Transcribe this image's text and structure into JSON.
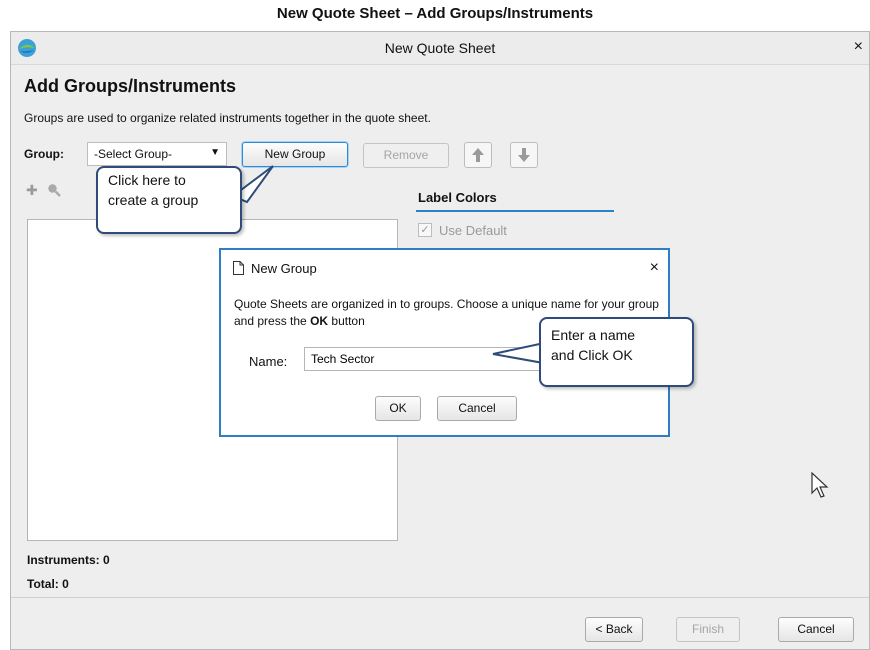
{
  "doc_title": "New Quote Sheet – Add Groups/Instruments",
  "window": {
    "title": "New Quote Sheet",
    "close": "×",
    "heading": "Add Groups/Instruments",
    "description": "Groups are used to organize related instruments together in the quote sheet."
  },
  "group_row": {
    "label": "Group:",
    "selected": "-Select Group-",
    "dropdown_arrow": "▼",
    "new_group": "New Group",
    "remove": "Remove",
    "up_icon": "arrow-up-icon",
    "down_icon": "arrow-down-icon"
  },
  "toolbar_icons": [
    "plus-icon",
    "zoom-icon"
  ],
  "label_colors": {
    "heading": "Label Colors",
    "use_default": "Use Default",
    "use_default_checked": true
  },
  "counts": {
    "instruments": "Instruments: 0",
    "total": "Total: 0"
  },
  "footer": {
    "back": "< Back",
    "finish": "Finish",
    "cancel": "Cancel"
  },
  "dialog": {
    "title": "New Group",
    "close": "×",
    "text_before": "Quote Sheets are organized in to groups. Choose a unique name for your group and press the ",
    "text_bold": "OK",
    "text_after": " button",
    "name_label": "Name:",
    "name_value": "Tech Sector",
    "ok": "OK",
    "cancel": "Cancel"
  },
  "callouts": {
    "group_hint_line1": "Click here to",
    "group_hint_line2": "create a group",
    "name_hint_line1": "Enter a name",
    "name_hint_line2": "and Click OK"
  },
  "colors": {
    "accent": "#2f7ec4",
    "callout_border": "#2e4b7a"
  }
}
